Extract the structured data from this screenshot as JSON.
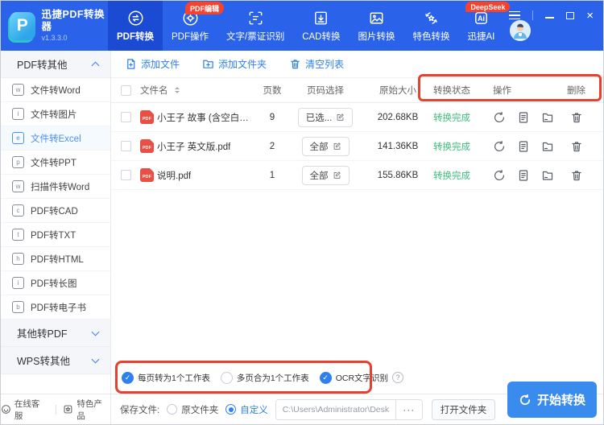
{
  "app": {
    "name": "迅捷PDF转换器",
    "version": "v1.3.3.0",
    "logo_letter": "P"
  },
  "topnav": {
    "tabs": [
      {
        "label": "PDF转换",
        "active": true
      },
      {
        "label": "PDF操作",
        "badge": "PDF编辑"
      },
      {
        "label": "文字/票证识别"
      },
      {
        "label": "CAD转换"
      },
      {
        "label": "图片转换"
      },
      {
        "label": "特色转换"
      },
      {
        "label": "迅捷AI",
        "badge": "DeepSeek"
      }
    ],
    "ai_icon_label": "Ai"
  },
  "sidebar": {
    "section_pdf_to_other": "PDF转其他",
    "items": [
      {
        "label": "文件转Word",
        "glyph": "w"
      },
      {
        "label": "文件转图片",
        "glyph": "i"
      },
      {
        "label": "文件转Excel",
        "glyph": "e",
        "active": true
      },
      {
        "label": "文件转PPT",
        "glyph": "p"
      },
      {
        "label": "扫描件转Word",
        "glyph": "w"
      },
      {
        "label": "PDF转CAD",
        "glyph": "c"
      },
      {
        "label": "PDF转TXT",
        "glyph": "t"
      },
      {
        "label": "PDF转HTML",
        "glyph": "h"
      },
      {
        "label": "PDF转长图",
        "glyph": "i"
      },
      {
        "label": "PDF转电子书",
        "glyph": "b"
      }
    ],
    "section_other_to_pdf": "其他转PDF",
    "section_wps": "WPS转其他"
  },
  "toolbar": {
    "add_file": "添加文件",
    "add_folder": "添加文件夹",
    "clear_list": "清空列表"
  },
  "table": {
    "headers": {
      "name": "文件名",
      "pages": "页数",
      "page_select": "页码选择",
      "size": "原始大小",
      "status": "转换状态",
      "actions": "操作",
      "delete": "删除"
    },
    "pdf_icon_label": "PDF",
    "rows": [
      {
        "name": "小王子 故事 (含空白页).pdf",
        "pages": "9",
        "page_select": "已选...",
        "size": "202.68KB",
        "status": "转换完成"
      },
      {
        "name": "小王子 英文版.pdf",
        "pages": "2",
        "page_select": "全部",
        "size": "141.36KB",
        "status": "转换完成"
      },
      {
        "name": "说明.pdf",
        "pages": "1",
        "page_select": "全部",
        "size": "155.86KB",
        "status": "转换完成"
      }
    ]
  },
  "options": {
    "sheet_per_page": {
      "label": "每页转为1个工作表",
      "checked": true
    },
    "merge_pages": {
      "label": "多页合为1个工作表",
      "checked": false
    },
    "ocr": {
      "label": "OCR文字识别",
      "checked": true
    },
    "check_glyph": "✓",
    "help_glyph": "?"
  },
  "statusbar": {
    "support": "在线客服",
    "products": "特色产品"
  },
  "save": {
    "label": "保存文件:",
    "original": "原文件夹",
    "custom": "自定义",
    "path": "C:\\Users\\Administrator\\Desktop",
    "more": "···",
    "open_folder": "打开文件夹"
  },
  "start_button": {
    "label": "开始转换"
  },
  "colors": {
    "topbar": "#2a63e9",
    "active_tab": "#1b4bd2",
    "accent": "#2e80f0",
    "badge_red": "#f4432f",
    "annotation_red": "#e8402f",
    "status_green": "#3cba7e",
    "start_button": "#3a8bee"
  }
}
